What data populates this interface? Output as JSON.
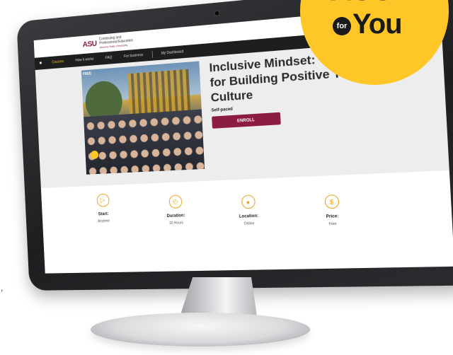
{
  "promo": {
    "line1": "ASU",
    "for": "for",
    "you": "You"
  },
  "brand": {
    "logo": "ASU",
    "line1": "Continuing and",
    "line2": "Professional Education",
    "line3": "Arizona State University"
  },
  "nav": {
    "home_icon": "home-icon",
    "items": [
      "Courses",
      "How it works",
      "FAQ",
      "For business",
      "My Dashboard"
    ]
  },
  "course": {
    "tag": "FREE",
    "title": "Inclusive Mindset: Tools for Building Positive Team Culture",
    "pace": "Self-paced",
    "enroll_label": "ENROLL"
  },
  "details": [
    {
      "icon": "play-icon",
      "label": "Start:",
      "value": "Anytime"
    },
    {
      "icon": "clock-icon",
      "label": "Duration:",
      "value": "20 Hours"
    },
    {
      "icon": "location-pin-icon",
      "label": "Location:",
      "value": "Online"
    },
    {
      "icon": "dollar-icon",
      "label": "Price:",
      "value": "Free"
    }
  ],
  "colors": {
    "maroon": "#8c1d40",
    "gold": "#ffc627",
    "nav_bg": "#1e1e1e"
  },
  "stray_text": ","
}
